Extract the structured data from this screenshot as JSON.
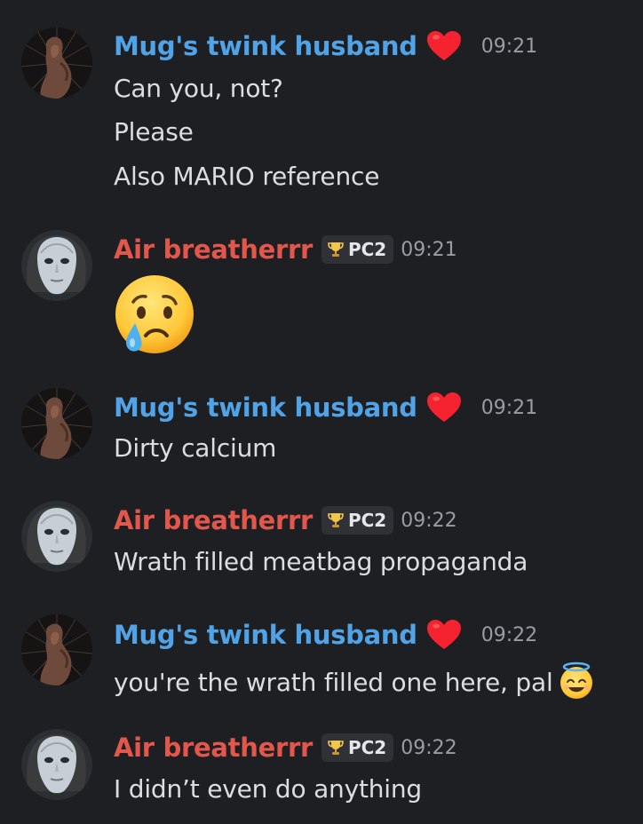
{
  "users": {
    "mug": {
      "name": "Mug's twink husband",
      "color": "#4fa3e6"
    },
    "air": {
      "name": "Air breatherrr",
      "color": "#e2574c",
      "badge": "PC2"
    }
  },
  "messages": [
    {
      "author": "Mug's twink husband",
      "time": "09:21",
      "lines": [
        "Can you, not?",
        "Please",
        "Also MARIO reference"
      ]
    },
    {
      "author": "Air breatherrr",
      "badge": "PC2",
      "time": "09:21",
      "emoji": "crying-face"
    },
    {
      "author": "Mug's twink husband",
      "time": "09:21",
      "lines": [
        "Dirty calcium"
      ]
    },
    {
      "author": "Air breatherrr",
      "badge": "PC2",
      "time": "09:22",
      "lines": [
        "Wrath filled meatbag propaganda"
      ]
    },
    {
      "author": "Mug's twink husband",
      "time": "09:22",
      "lines": [
        "you're the wrath filled one here, pal"
      ],
      "trailing_emoji": "smiling-face-with-halo"
    },
    {
      "author": "Air breatherrr",
      "badge": "PC2",
      "time": "09:22",
      "lines": [
        "I didn’t even do anything"
      ]
    }
  ]
}
